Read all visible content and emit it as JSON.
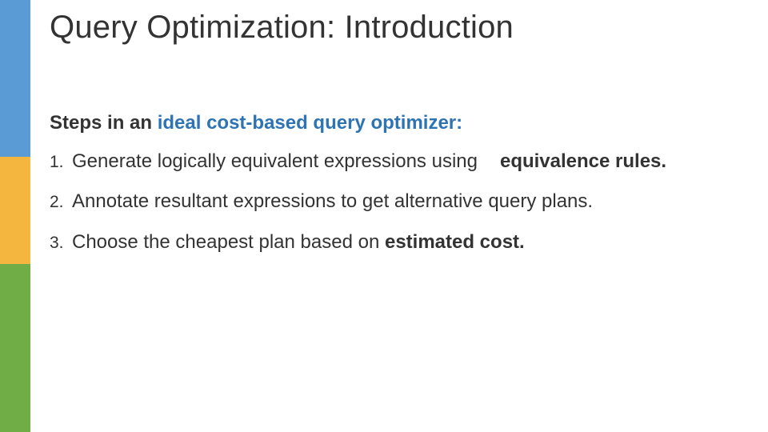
{
  "title": "Query Optimization: Introduction",
  "subhead_prefix": "Steps in an ",
  "subhead_accent": "ideal cost-based query optimizer:",
  "items": {
    "n1": "1.",
    "t1a": "Generate logically equivalent expressions using",
    "t1b": "equivalence rules.",
    "n2": "2.",
    "t2": "Annotate resultant expressions to get alternative query plans.",
    "n3": "3.",
    "t3a": "Choose the cheapest plan based on ",
    "t3b": "estimated cost."
  }
}
